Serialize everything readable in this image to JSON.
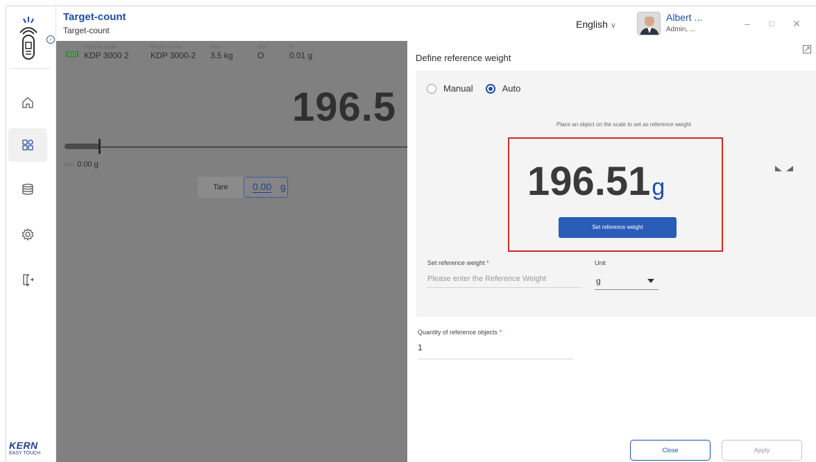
{
  "header": {
    "title": "Target-count",
    "subtitle": "Target-count",
    "language": "English",
    "user_name": "Albert ...",
    "user_role": "Admin, ..."
  },
  "brand": {
    "name": "KERN",
    "tagline": "EASY TOUCH"
  },
  "sidebar": {
    "items": [
      {
        "icon": "home-icon",
        "active": false
      },
      {
        "icon": "apps-icon",
        "active": true
      },
      {
        "icon": "database-icon",
        "active": false
      },
      {
        "icon": "gear-icon",
        "active": false
      },
      {
        "icon": "logout-icon",
        "active": false
      }
    ]
  },
  "scale_info": {
    "internal_code_label": "Internal code",
    "internal_code": "KDP 3000 2",
    "model_name_label": "Model name",
    "model_name": "KDP 3000-2",
    "max_label": "Max",
    "max": "3.5 kg",
    "min_label": "Min",
    "min": "O",
    "d_label": "d",
    "d": "0.01 g"
  },
  "display": {
    "weight": "196.5",
    "min_label": "Min:",
    "min_value": "0.00 g",
    "tare_label": "Tare",
    "tare_value": "0.00",
    "tare_unit": "g"
  },
  "dialog": {
    "title": "Define reference weight",
    "mode_manual": "Manual",
    "mode_auto": "Auto",
    "selected_mode": "Auto",
    "hint": "Place an object on the  scale to set as reference weight",
    "ref_weight_value": "196.51",
    "ref_weight_unit": "g",
    "set_ref_button": "Set reference weight",
    "ref_weight_field_label": "Set reference weight",
    "ref_weight_placeholder": "Please enter the Reference Weight",
    "unit_label": "Unit",
    "unit_value": "g",
    "qty_label": "Quantity of reference objects",
    "qty_value": "1",
    "close_button": "Close",
    "apply_button": "Apply"
  },
  "colors": {
    "accent": "#1f4ea6",
    "button_primary": "#2a5db8",
    "highlight": "#cc2a2a",
    "overlay": "#808080"
  }
}
